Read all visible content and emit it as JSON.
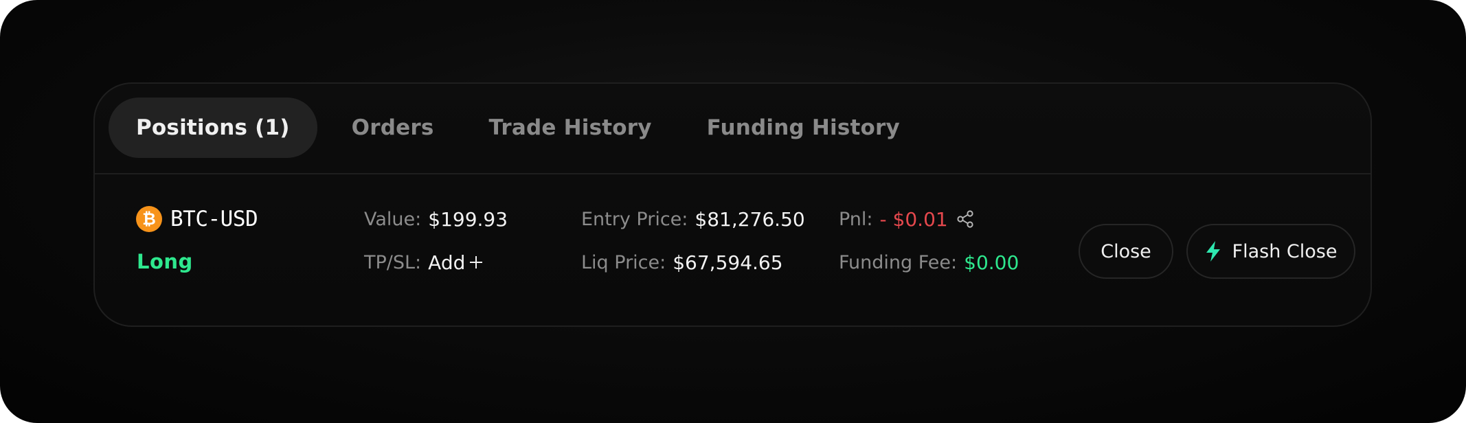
{
  "tabs": [
    {
      "label": "Positions (1)",
      "active": true
    },
    {
      "label": "Orders",
      "active": false
    },
    {
      "label": "Trade History",
      "active": false
    },
    {
      "label": "Funding History",
      "active": false
    }
  ],
  "position": {
    "coin_icon": "bitcoin-icon",
    "coin_glyph": "₿",
    "symbol": "BTC-USD",
    "side": "Long",
    "value_label": "Value:",
    "value": "$199.93",
    "tpsl_label": "TP/SL:",
    "tpsl_action": "Add",
    "tpsl_action_icon": "plus-icon",
    "entry_label": "Entry Price:",
    "entry_price": "$81,276.50",
    "liq_label": "Liq Price:",
    "liq_price": "$67,594.65",
    "pnl_label": "Pnl:",
    "pnl": "- $0.01",
    "pnl_share_icon": "share-icon",
    "funding_label": "Funding Fee:",
    "funding_fee": "$0.00"
  },
  "actions": {
    "close_label": "Close",
    "flash_close_label": "Flash Close",
    "flash_icon": "lightning-bolt-icon"
  },
  "colors": {
    "long": "#2EE88E",
    "loss": "#E5484D",
    "bitcoin": "#F7931A",
    "flash_icon": "#2EE8B0"
  }
}
